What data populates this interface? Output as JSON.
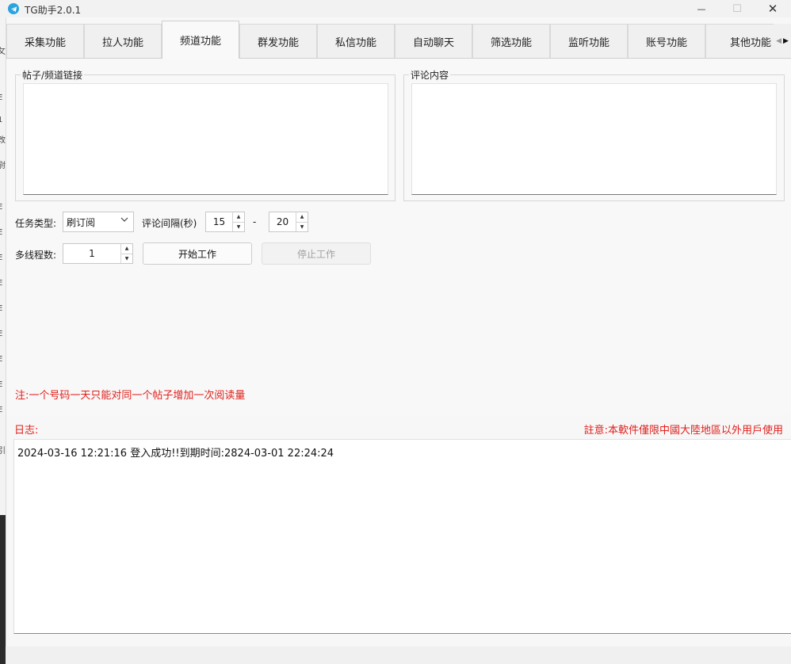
{
  "window": {
    "title": "TG助手2.0.1",
    "controls": {
      "minimize": "—",
      "maximize": "☐",
      "close": "✕"
    }
  },
  "tabs": [
    {
      "label": "采集功能",
      "active": false
    },
    {
      "label": "拉人功能",
      "active": false
    },
    {
      "label": "频道功能",
      "active": true
    },
    {
      "label": "群发功能",
      "active": false
    },
    {
      "label": "私信功能",
      "active": false
    },
    {
      "label": "自动聊天",
      "active": false
    },
    {
      "label": "筛选功能",
      "active": false
    },
    {
      "label": "监听功能",
      "active": false
    },
    {
      "label": "账号功能",
      "active": false
    },
    {
      "label": "其他功能",
      "active": false
    }
  ],
  "channel": {
    "post_links_group": "帖子/频道链接",
    "post_links_value": "",
    "comment_group": "评论内容",
    "comment_value": "",
    "task_type_label": "任务类型:",
    "task_type_value": "刷订阅",
    "interval_label": "评论间隔(秒)",
    "interval_min": "15",
    "interval_sep": "-",
    "interval_max": "20",
    "threads_label": "多线程数:",
    "threads_value": "1",
    "start_button": "开始工作",
    "stop_button": "停止工作",
    "note": "注:一个号码一天只能对同一个帖子增加一次阅读量"
  },
  "log": {
    "label": "日志:",
    "notice": "註意:本軟件僅限中國大陸地區以外用戶使用",
    "lines": [
      "2024-03-16 12:21:16 登入成功!!到期时间:2824-03-01 22:24:24"
    ]
  },
  "colors": {
    "accent_red": "#e0201c",
    "app_icon": "#2aa3df"
  }
}
